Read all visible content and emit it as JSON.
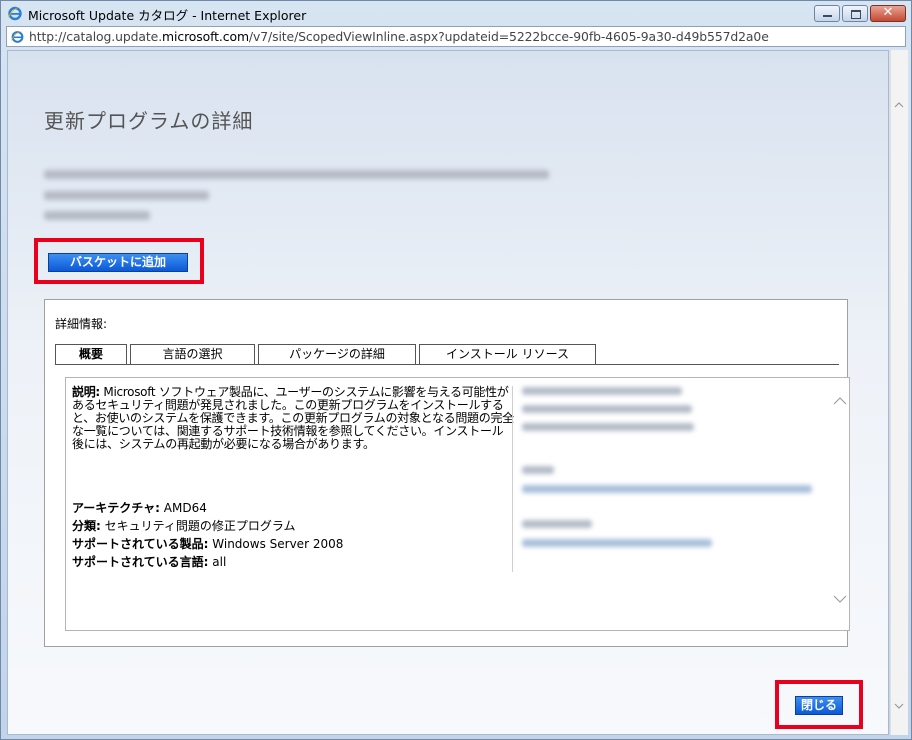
{
  "window": {
    "title": "Microsoft Update カタログ - Internet Explorer",
    "url_prefix": "http://catalog.update.",
    "url_domain": "microsoft.com",
    "url_suffix": "/v7/site/ScopedViewInline.aspx?updateid=5222bcce-90fb-4605-9a30-d49b557d2a0e"
  },
  "page": {
    "title": "更新プログラムの詳細",
    "basket_button": "バスケットに追加",
    "details_label": "詳細情報:",
    "tabs": [
      "概要",
      "言語の選択",
      "パッケージの詳細",
      "インストール リソース"
    ],
    "close_button": "閉じる"
  },
  "overview": {
    "desc_label": "説明:",
    "desc_text": " Microsoft ソフトウェア製品に、ユーザーのシステムに影響を与える可能性があるセキュリティ問題が発見されました。この更新プログラムをインストールすると、お使いのシステムを保護できます。この更新プログラムの対象となる問題の完全な一覧については、関連するサポート技術情報を参照してください。インストール後には、システムの再起動が必要になる場合があります。",
    "arch_label": "アーキテクチャ:",
    "arch_value": " AMD64",
    "class_label": "分類:",
    "class_value": " セキュリティ問題の修正プログラム",
    "product_label": "サポートされている製品:",
    "product_value": " Windows Server 2008",
    "lang_label": "サポートされている言語:",
    "lang_value": " all"
  },
  "colors": {
    "accent_red": "#e8001c",
    "button_blue": "#0b59d9"
  }
}
